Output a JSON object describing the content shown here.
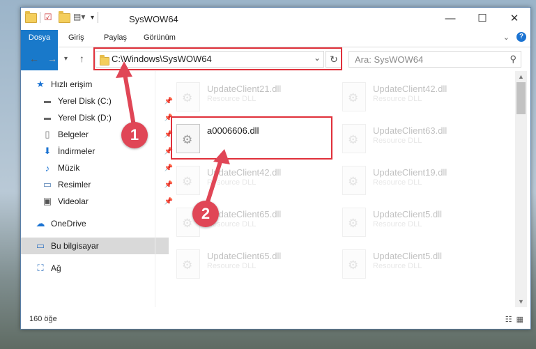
{
  "window": {
    "title": "SysWOW64"
  },
  "ribbon": {
    "tabs": [
      "Dosya",
      "Giriş",
      "Paylaş",
      "Görünüm"
    ]
  },
  "address": {
    "path": "C:\\Windows\\SysWOW64"
  },
  "search": {
    "placeholder": "Ara: SysWOW64"
  },
  "sidebar": {
    "items": [
      {
        "label": "Hızlı erişim",
        "icon": "star-icon"
      },
      {
        "label": "Yerel Disk (C:)",
        "icon": "drive-icon"
      },
      {
        "label": "Yerel Disk (D:)",
        "icon": "drive-icon"
      },
      {
        "label": "Belgeler",
        "icon": "documents-icon"
      },
      {
        "label": "İndirmeler",
        "icon": "download-icon"
      },
      {
        "label": "Müzik",
        "icon": "music-icon"
      },
      {
        "label": "Resimler",
        "icon": "pictures-icon"
      },
      {
        "label": "Videolar",
        "icon": "video-icon"
      },
      {
        "label": "OneDrive",
        "icon": "cloud-icon"
      },
      {
        "label": "Bu bilgisayar",
        "icon": "computer-icon"
      },
      {
        "label": "Ağ",
        "icon": "network-icon"
      }
    ]
  },
  "files": {
    "left": [
      {
        "name": "UpdateClient21.dll",
        "type": "Resource DLL"
      },
      {
        "name": "a0006606.dll",
        "type": ""
      },
      {
        "name": "UpdateClient42.dll",
        "type": "Resource DLL"
      },
      {
        "name": "UpdateClient65.dll",
        "type": "Resource DLL"
      },
      {
        "name": "UpdateClient65.dll",
        "type": "Resource DLL"
      }
    ],
    "right": [
      {
        "name": "UpdateClient42.dll",
        "type": "Resource DLL"
      },
      {
        "name": "UpdateClient63.dll",
        "type": "Resource DLL"
      },
      {
        "name": "UpdateClient19.dll",
        "type": "Resource DLL"
      },
      {
        "name": "UpdateClient5.dll",
        "type": "Resource DLL"
      },
      {
        "name": "UpdateClient5.dll",
        "type": "Resource DLL"
      }
    ]
  },
  "status": {
    "count": "160 öğe"
  },
  "annotations": {
    "step1": "1",
    "step2": "2"
  },
  "colors": {
    "accent": "#1979ca",
    "highlight": "#e0303a",
    "badge": "#e04656"
  }
}
